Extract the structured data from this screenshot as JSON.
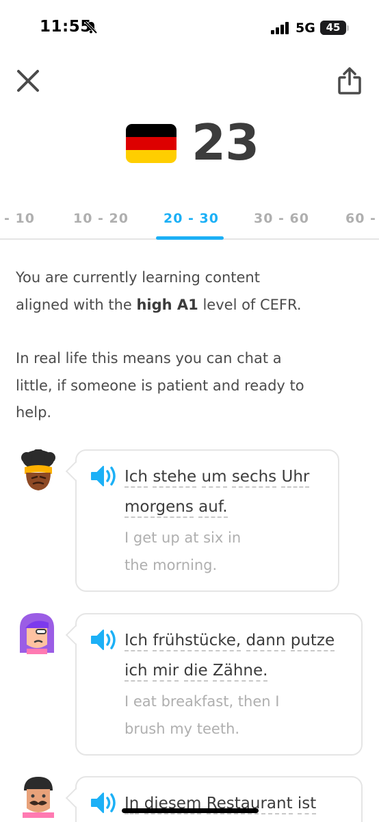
{
  "status_bar": {
    "time": "11:55",
    "network": "5G",
    "battery": "45",
    "battery_percent": 45
  },
  "header": {
    "flag": "germany-flag",
    "score": "23",
    "flag_colors": [
      "#000000",
      "#dd0000",
      "#ffce00"
    ]
  },
  "tabs": [
    {
      "label": "- 10",
      "active": false
    },
    {
      "label": "10 - 20",
      "active": false
    },
    {
      "label": "20 - 30",
      "active": true
    },
    {
      "label": "30 - 60",
      "active": false
    },
    {
      "label": "60 -",
      "active": false
    }
  ],
  "description": {
    "line1_pre": "You are currently learning content",
    "line2_pre": "aligned with the ",
    "line2_bold": "high A1",
    "line2_post": " level of CEFR.",
    "para2_line1": "In real life this means you can chat a",
    "para2_line2": "little, if someone is patient and ready to",
    "para2_line3": "help."
  },
  "examples": [
    {
      "avatar": "woman-headscarf-avatar",
      "german_lines": [
        [
          "Ich",
          "stehe",
          "um",
          "sechs",
          "Uhr"
        ],
        [
          "morgens",
          "auf."
        ]
      ],
      "english_lines": [
        "I get up at six in",
        "the morning."
      ]
    },
    {
      "avatar": "purple-hair-avatar",
      "german_lines": [
        [
          "Ich",
          "frühstücke,",
          "dann",
          "putze"
        ],
        [
          "ich",
          "mir",
          "die",
          "Zähne."
        ]
      ],
      "english_lines": [
        "I eat breakfast, then I",
        "brush my teeth."
      ]
    },
    {
      "avatar": "mustache-man-avatar",
      "german_lines": [
        [
          "In",
          "diesem",
          "Restaurant",
          "ist"
        ]
      ],
      "english_lines": []
    }
  ],
  "colors": {
    "accent": "#1cb0f6",
    "text": "#4b4b4b",
    "muted": "#afafaf",
    "border": "#e5e5e5"
  }
}
